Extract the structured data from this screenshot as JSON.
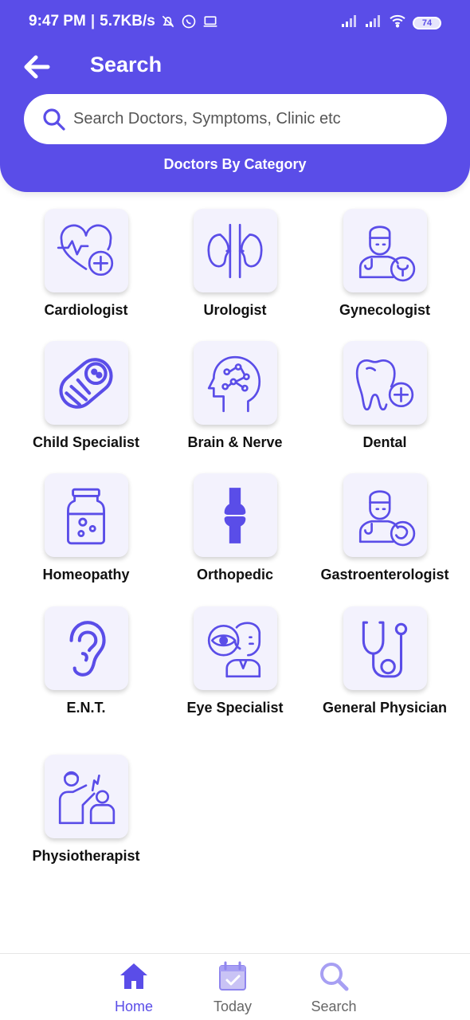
{
  "status_bar": {
    "time": "9:47 PM",
    "separator": "|",
    "speed": "5.7KB/s",
    "battery": "74"
  },
  "header": {
    "title": "Search",
    "search_placeholder": "Search Doctors, Symptoms, Clinic etc",
    "subtitle": "Doctors By Category"
  },
  "categories": [
    {
      "label": "Cardiologist",
      "icon": "heart-plus-icon"
    },
    {
      "label": "Urologist",
      "icon": "kidneys-icon"
    },
    {
      "label": "Gynecologist",
      "icon": "gynecologist-doctor-icon"
    },
    {
      "label": "Child Specialist",
      "icon": "baby-icon"
    },
    {
      "label": "Brain & Nerve",
      "icon": "brain-head-icon"
    },
    {
      "label": "Dental",
      "icon": "tooth-plus-icon"
    },
    {
      "label": "Homeopathy",
      "icon": "medicine-jar-icon"
    },
    {
      "label": "Orthopedic",
      "icon": "bone-joint-icon"
    },
    {
      "label": "Gastroenterologist",
      "icon": "gastro-doctor-icon"
    },
    {
      "label": "E.N.T.",
      "icon": "ear-icon"
    },
    {
      "label": "Eye Specialist",
      "icon": "eye-doctor-icon"
    },
    {
      "label": "General Physician",
      "icon": "stethoscope-icon"
    },
    {
      "label": "Physiotherapist",
      "icon": "physiotherapy-icon"
    }
  ],
  "bottom_nav": {
    "items": [
      {
        "label": "Home",
        "icon": "home-icon"
      },
      {
        "label": "Today",
        "icon": "calendar-check-icon"
      },
      {
        "label": "Search",
        "icon": "search-icon"
      }
    ]
  },
  "colors": {
    "primary": "#5a4de8",
    "tile_bg": "#f3f2fd"
  }
}
